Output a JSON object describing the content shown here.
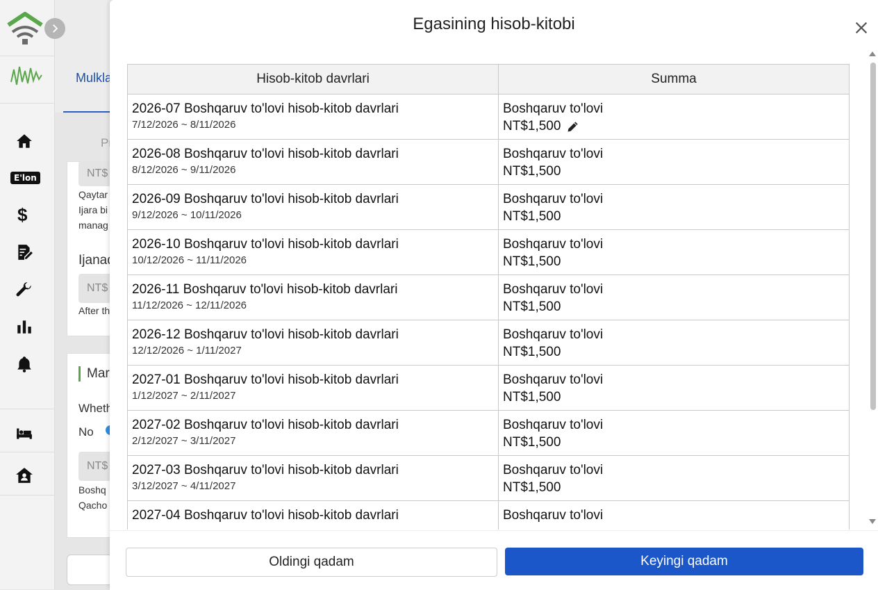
{
  "colors": {
    "accent": "#1b57c9",
    "logo_green": "#5aa64a",
    "logo_gray": "#6a6a6a"
  },
  "sidebar": {
    "badge_label": "E'lon",
    "dollar_label": "$",
    "icons": [
      "home-icon",
      "dollar-icon",
      "contract-edit-icon",
      "wrench-icon",
      "bar-chart-icon",
      "bell-icon",
      "bed-icon",
      "house-user-icon"
    ]
  },
  "background": {
    "tab_label": "Mulkla",
    "tab2_label": "Pr",
    "input1": "NT$",
    "text1": "Qaytar",
    "text2": "Ijara bi",
    "text3": "manag",
    "label1": "Ijanad",
    "input2": "NT$",
    "text4": "After th",
    "section_title": "Mar",
    "label2": "Wheth",
    "radio_label": "No",
    "input3": "NT$",
    "text5": "Boshq",
    "text6": "Qacho"
  },
  "modal": {
    "title": "Egasining hisob-kitobi",
    "columns": [
      "Hisob-kitob davrlari",
      "Summa"
    ],
    "rows": [
      {
        "period": "2026-07 Boshqaruv to'lovi hisob-kitob davrlari",
        "range": "7/12/2026 ~ 8/11/2026",
        "type": "Boshqaruv to'lovi",
        "amount": "NT$1,500"
      },
      {
        "period": "2026-08 Boshqaruv to'lovi hisob-kitob davrlari",
        "range": "8/12/2026 ~ 9/11/2026",
        "type": "Boshqaruv to'lovi",
        "amount": "NT$1,500"
      },
      {
        "period": "2026-09 Boshqaruv to'lovi hisob-kitob davrlari",
        "range": "9/12/2026 ~ 10/11/2026",
        "type": "Boshqaruv to'lovi",
        "amount": "NT$1,500"
      },
      {
        "period": "2026-10 Boshqaruv to'lovi hisob-kitob davrlari",
        "range": "10/12/2026 ~ 11/11/2026",
        "type": "Boshqaruv to'lovi",
        "amount": "NT$1,500"
      },
      {
        "period": "2026-11 Boshqaruv to'lovi hisob-kitob davrlari",
        "range": "11/12/2026 ~ 12/11/2026",
        "type": "Boshqaruv to'lovi",
        "amount": "NT$1,500"
      },
      {
        "period": "2026-12 Boshqaruv to'lovi hisob-kitob davrlari",
        "range": "12/12/2026 ~ 1/11/2027",
        "type": "Boshqaruv to'lovi",
        "amount": "NT$1,500"
      },
      {
        "period": "2027-01 Boshqaruv to'lovi hisob-kitob davrlari",
        "range": "1/12/2027 ~ 2/11/2027",
        "type": "Boshqaruv to'lovi",
        "amount": "NT$1,500"
      },
      {
        "period": "2027-02 Boshqaruv to'lovi hisob-kitob davrlari",
        "range": "2/12/2027 ~ 3/11/2027",
        "type": "Boshqaruv to'lovi",
        "amount": "NT$1,500"
      },
      {
        "period": "2027-03 Boshqaruv to'lovi hisob-kitob davrlari",
        "range": "3/12/2027 ~ 4/11/2027",
        "type": "Boshqaruv to'lovi",
        "amount": "NT$1,500"
      },
      {
        "period": "2027-04 Boshqaruv to'lovi hisob-kitob davrlari",
        "range": "",
        "type": "Boshqaruv to'lovi",
        "amount": ""
      }
    ],
    "prev_label": "Oldingi qadam",
    "next_label": "Keyingi qadam"
  }
}
